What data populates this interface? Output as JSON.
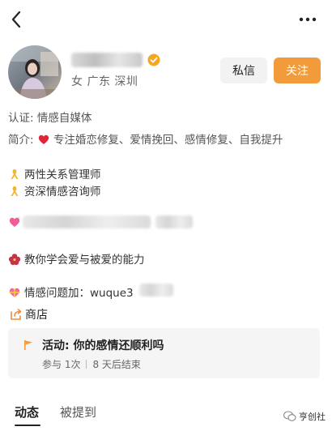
{
  "header": {
    "back_icon": "chevron-left-icon",
    "more_icon": "ellipsis-icon"
  },
  "profile": {
    "gender": "女",
    "location": "广东 深圳",
    "message_label": "私信",
    "follow_label": "关注",
    "accent_color": "#f29b3b"
  },
  "bio": {
    "certification": "认证: 情感自媒体",
    "intro_prefix": "简介:",
    "intro_text": "专注婚恋修复、爱情挽回、感情修复、自我提升",
    "title_1": "两性关系管理师",
    "title_2": "资深情感咨询师",
    "tagline": "教你学会爱与被爱的能力",
    "contact_prefix": "情感问题加：wuque3"
  },
  "shop": {
    "label": "商店"
  },
  "activity": {
    "title": "活动: 你的感情还顺利吗",
    "participation": "参与 1次",
    "ends": "8 天后结束"
  },
  "tabs": {
    "posts": "动态",
    "mentions": "被提到"
  },
  "watermark": {
    "text": "亨创社"
  }
}
